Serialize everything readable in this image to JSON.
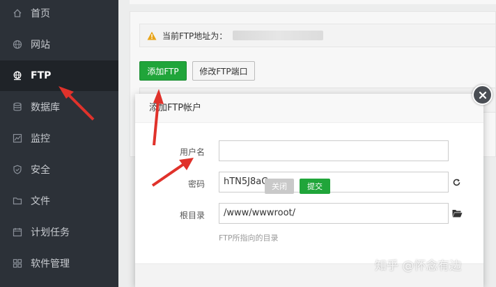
{
  "sidebar": {
    "items": [
      {
        "label": "首页",
        "icon": "home-icon"
      },
      {
        "label": "网站",
        "icon": "globe-icon"
      },
      {
        "label": "FTP",
        "icon": "ftp-globe-icon",
        "active": true
      },
      {
        "label": "数据库",
        "icon": "database-icon"
      },
      {
        "label": "监控",
        "icon": "monitor-chart-icon"
      },
      {
        "label": "安全",
        "icon": "shield-icon"
      },
      {
        "label": "文件",
        "icon": "folder-icon"
      },
      {
        "label": "计划任务",
        "icon": "calendar-icon"
      },
      {
        "label": "软件管理",
        "icon": "grid-apps-icon"
      }
    ]
  },
  "notice": {
    "text": "当前FTP地址为：",
    "icon": "warning-icon"
  },
  "toolbar": {
    "add_ftp_label": "添加FTP",
    "edit_port_label": "修改FTP端口"
  },
  "dialog": {
    "title": "添加FTP帐户",
    "username_label": "用户名",
    "username_value": "",
    "password_label": "密码",
    "password_value": "hTN5J8aCwr",
    "root_label": "根目录",
    "root_value": "/www/wwwroot/",
    "root_hint": "FTP所指向的目录",
    "close_label": "关闭",
    "submit_label": "提交"
  },
  "watermark": "知乎 @怀念有边",
  "colors": {
    "sidebar_bg": "#2c3138",
    "accent_green": "#20a53a",
    "annotation_red": "#e0322b"
  }
}
